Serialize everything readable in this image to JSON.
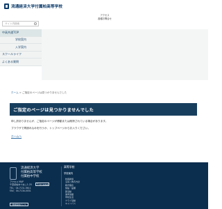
{
  "header": {
    "logo_text": "流通経済大学付属柏高等学校",
    "logo_icon": "school-crest-icon"
  },
  "search": {
    "placeholder": "サイト内検索",
    "icon": "search-icon"
  },
  "access": {
    "line1": "アクセス",
    "line2": "各種お問合せ"
  },
  "nav": {
    "items": [
      {
        "label": "中高共通TOP"
      },
      {
        "label": "学校案内"
      },
      {
        "label": "入学案内"
      },
      {
        "label": "スクールライフ"
      },
      {
        "label": "よくある質問"
      }
    ]
  },
  "breadcrumb": {
    "home": "ホーム",
    "sep": " > ",
    "current": "ご指定のページは見つかりませんでした"
  },
  "error": {
    "title": "ご指定のページは見つかりませんでした",
    "message1": "申し訳ありませんが、ご指定のページが移動または削除されている場合があります。",
    "message2": "ブラウザで再読み込みを行うか、トップページからお入りください。",
    "back_link": "ホームへ"
  },
  "footer": {
    "school_names": [
      "流通経済大学",
      "付属柏高等学校",
      "付属柏中学校"
    ],
    "info_lines": [
      "アクセス MAP",
      "千葉県柏市十余二1-20",
      "TEL：04-7131-5611",
      "FAX：04-7134-0031"
    ],
    "access_button": "アクセスMAP",
    "pamphlet_button": "学校案内パンフ",
    "heading": "高等学校",
    "sub": "学校案内",
    "links": [
      "校長挨拶",
      "沿革と教育方針",
      "教育理念",
      "施設・設備",
      "部活動",
      "進学実績",
      "学校生活",
      "クラブ活動",
      "キャンパス",
      "お知らせ"
    ]
  },
  "colors": {
    "brand": "#0b3b6b",
    "banner": "#183e5e",
    "footer": "#0c2e4e",
    "link": "#2c6aa0"
  }
}
